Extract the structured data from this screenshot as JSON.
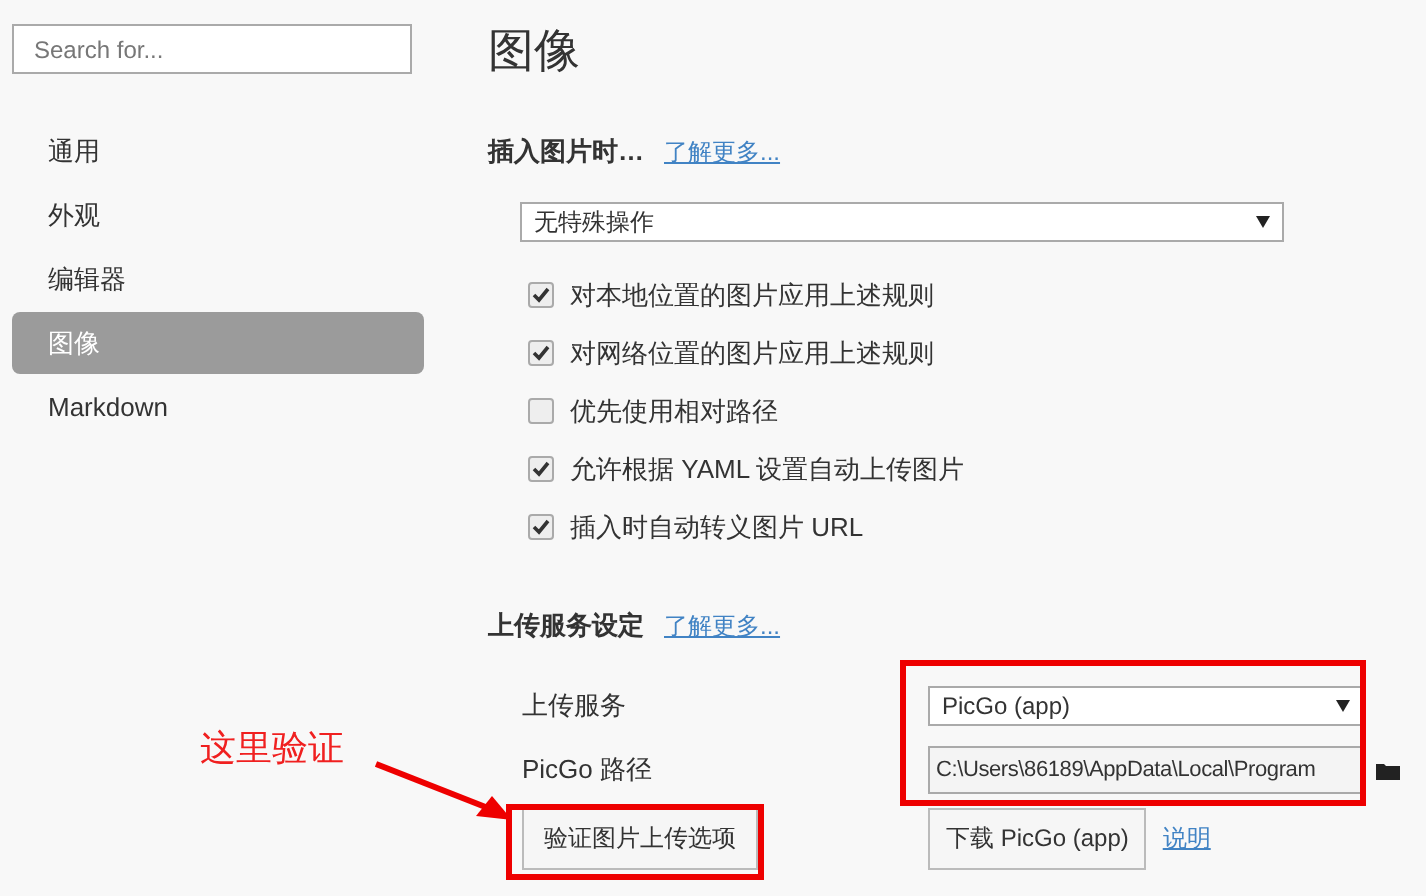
{
  "sidebar": {
    "search": {
      "placeholder": "Search for..."
    },
    "items": [
      {
        "label": "通用",
        "selected": false
      },
      {
        "label": "外观",
        "selected": false
      },
      {
        "label": "编辑器",
        "selected": false
      },
      {
        "label": "图像",
        "selected": true
      },
      {
        "label": "Markdown",
        "selected": false
      }
    ]
  },
  "title": "图像",
  "insert_section": {
    "heading": "插入图片时…",
    "link": "了解更多...",
    "select": {
      "value": "无特殊操作"
    },
    "options": [
      {
        "label": "对本地位置的图片应用上述规则",
        "checked": true
      },
      {
        "label": "对网络位置的图片应用上述规则",
        "checked": true
      },
      {
        "label": "优先使用相对路径",
        "checked": false
      },
      {
        "label": "允许根据 YAML 设置自动上传图片",
        "checked": true
      },
      {
        "label": "插入时自动转义图片 URL",
        "checked": true
      }
    ]
  },
  "upload_section": {
    "heading": "上传服务设定",
    "link": "了解更多...",
    "service": {
      "label": "上传服务",
      "value": "PicGo (app)"
    },
    "path": {
      "label": "PicGo 路径",
      "value": "C:\\Users\\86189\\AppData\\Local\\Program"
    },
    "verify_button": "验证图片上传选项",
    "download_button": "下载 PicGo (app)",
    "help_link": "说明"
  },
  "annotation": {
    "text": "这里验证"
  }
}
